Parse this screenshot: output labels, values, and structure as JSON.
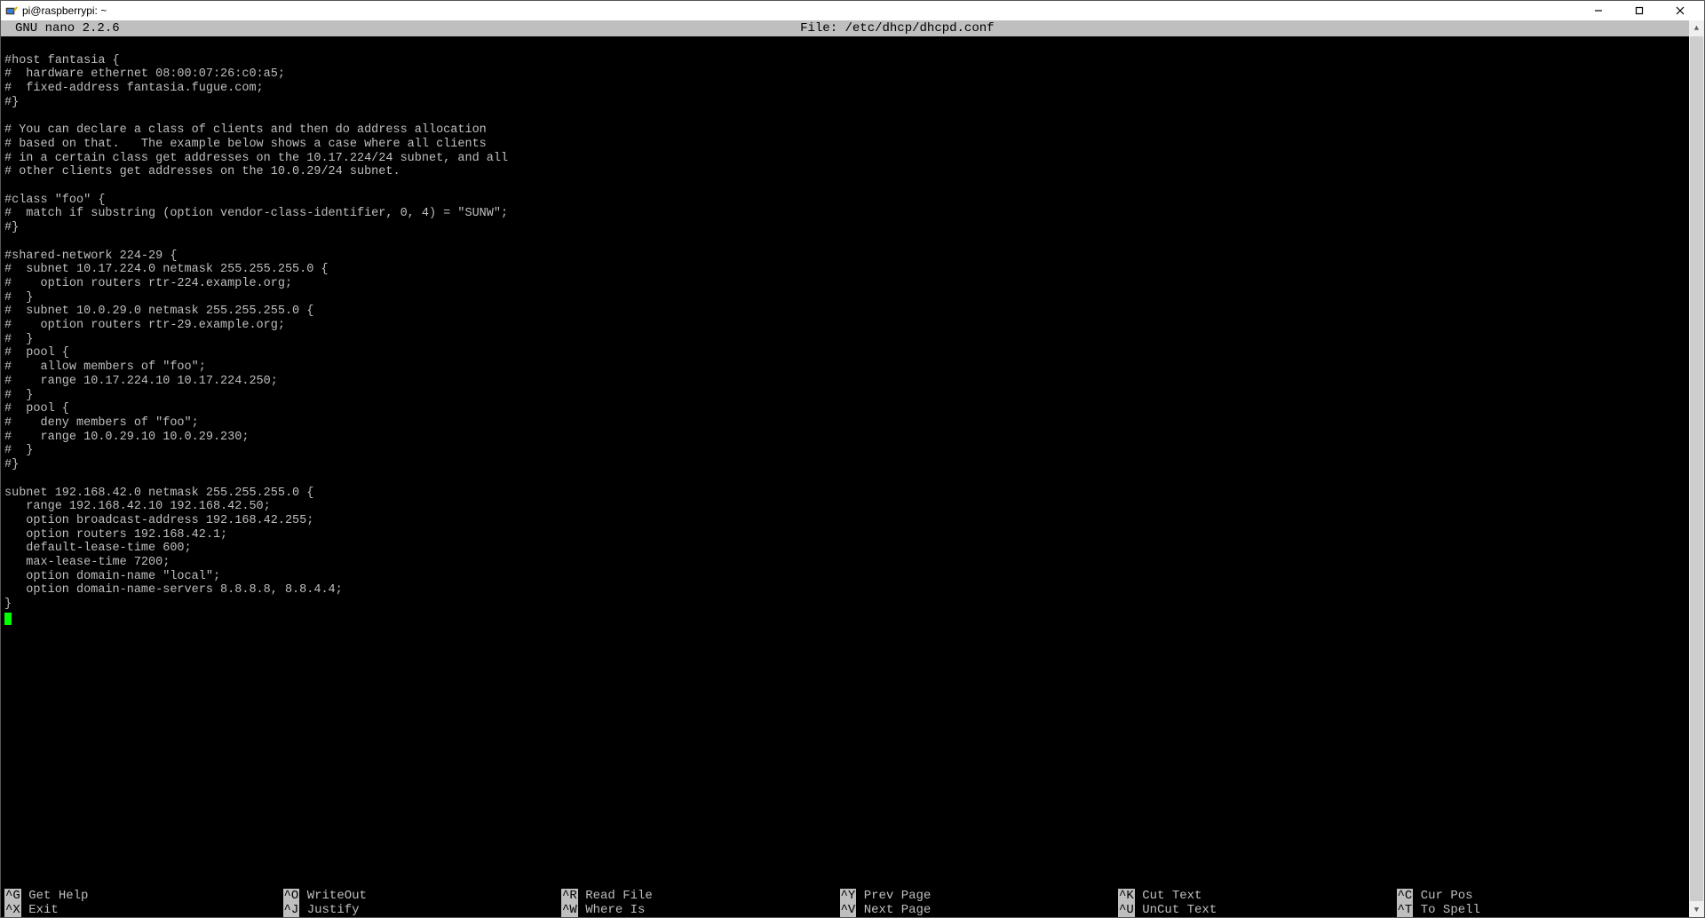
{
  "window": {
    "title": "pi@raspberrypi: ~"
  },
  "nano": {
    "version": "GNU nano 2.2.6",
    "file_label": "File: /etc/dhcp/dhcpd.conf"
  },
  "editor": {
    "lines": [
      "",
      "#host fantasia {",
      "#  hardware ethernet 08:00:07:26:c0:a5;",
      "#  fixed-address fantasia.fugue.com;",
      "#}",
      "",
      "# You can declare a class of clients and then do address allocation",
      "# based on that.   The example below shows a case where all clients",
      "# in a certain class get addresses on the 10.17.224/24 subnet, and all",
      "# other clients get addresses on the 10.0.29/24 subnet.",
      "",
      "#class \"foo\" {",
      "#  match if substring (option vendor-class-identifier, 0, 4) = \"SUNW\";",
      "#}",
      "",
      "#shared-network 224-29 {",
      "#  subnet 10.17.224.0 netmask 255.255.255.0 {",
      "#    option routers rtr-224.example.org;",
      "#  }",
      "#  subnet 10.0.29.0 netmask 255.255.255.0 {",
      "#    option routers rtr-29.example.org;",
      "#  }",
      "#  pool {",
      "#    allow members of \"foo\";",
      "#    range 10.17.224.10 10.17.224.250;",
      "#  }",
      "#  pool {",
      "#    deny members of \"foo\";",
      "#    range 10.0.29.10 10.0.29.230;",
      "#  }",
      "#}",
      "",
      "subnet 192.168.42.0 netmask 255.255.255.0 {",
      "   range 192.168.42.10 192.168.42.50;",
      "   option broadcast-address 192.168.42.255;",
      "   option routers 192.168.42.1;",
      "   default-lease-time 600;",
      "   max-lease-time 7200;",
      "   option domain-name \"local\";",
      "   option domain-name-servers 8.8.8.8, 8.8.4.4;",
      "}"
    ]
  },
  "shortcuts": {
    "row1": [
      {
        "key": "^G",
        "label": "Get Help"
      },
      {
        "key": "^O",
        "label": "WriteOut"
      },
      {
        "key": "^R",
        "label": "Read File"
      },
      {
        "key": "^Y",
        "label": "Prev Page"
      },
      {
        "key": "^K",
        "label": "Cut Text"
      },
      {
        "key": "^C",
        "label": "Cur Pos"
      }
    ],
    "row2": [
      {
        "key": "^X",
        "label": "Exit"
      },
      {
        "key": "^J",
        "label": "Justify"
      },
      {
        "key": "^W",
        "label": "Where Is"
      },
      {
        "key": "^V",
        "label": "Next Page"
      },
      {
        "key": "^U",
        "label": "UnCut Text"
      },
      {
        "key": "^T",
        "label": "To Spell"
      }
    ]
  }
}
